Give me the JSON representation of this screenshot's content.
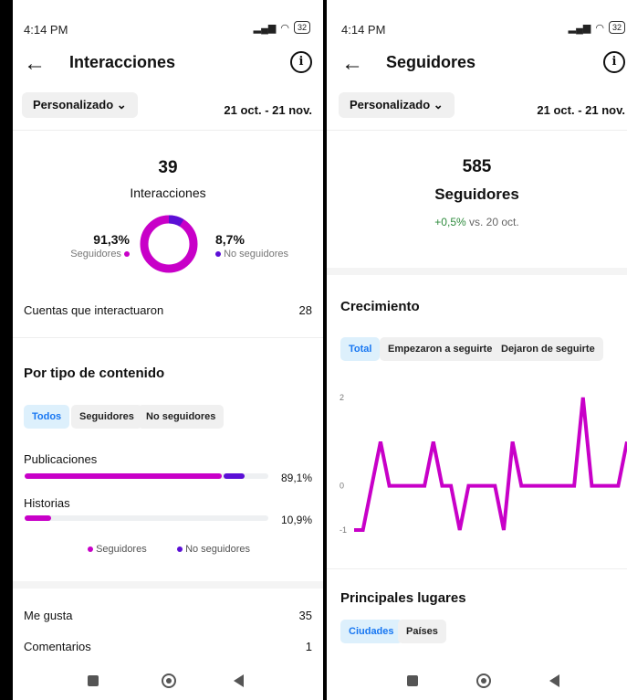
{
  "colors": {
    "magenta": "#c800c8",
    "purple": "#5b0fd6",
    "green": "#2e8b3d",
    "blue": "#1877f2"
  },
  "left": {
    "status": {
      "time": "4:14 PM",
      "battery": "32"
    },
    "header": {
      "title": "Interacciones"
    },
    "filter": {
      "dropdown": "Personalizado",
      "range": "21 oct. - 21 nov."
    },
    "summary": {
      "total": "39",
      "label": "Interacciones",
      "followers_pct": "91,3%",
      "followers_label": "Seguidores",
      "nonfollowers_pct": "8,7%",
      "nonfollowers_label": "No seguidores",
      "donut_followers_fraction": 0.913
    },
    "accounts": {
      "label": "Cuentas que interactuaron",
      "value": "28"
    },
    "by_type": {
      "title": "Por tipo de contenido",
      "tabs": [
        "Todos",
        "Seguidores",
        "No seguidores"
      ],
      "items": [
        {
          "label": "Publicaciones",
          "pct": "89,1%",
          "followers_fraction": 0.81,
          "nonfollowers_fraction": 0.085
        },
        {
          "label": "Historias",
          "pct": "10,9%",
          "followers_fraction": 0.109,
          "nonfollowers_fraction": 0
        }
      ],
      "legend_followers": "Seguidores",
      "legend_nonfollowers": "No seguidores"
    },
    "stats": [
      {
        "label": "Me gusta",
        "value": "35"
      },
      {
        "label": "Comentarios",
        "value": "1"
      }
    ]
  },
  "right": {
    "status": {
      "time": "4:14 PM",
      "battery": "32"
    },
    "header": {
      "title": "Seguidores"
    },
    "filter": {
      "dropdown": "Personalizado",
      "range": "21 oct. - 21 nov."
    },
    "summary": {
      "total": "585",
      "label": "Seguidores",
      "change": "+0,5%",
      "change_suffix": "vs. 20 oct."
    },
    "growth": {
      "title": "Crecimiento",
      "tabs": [
        "Total",
        "Empezaron a seguirte",
        "Dejaron de seguirte"
      ]
    },
    "places": {
      "title": "Principales lugares",
      "tabs": [
        "Ciudades",
        "Países"
      ]
    }
  },
  "chart_data": {
    "type": "line",
    "y_ticks": [
      "2",
      "0",
      "-1"
    ],
    "ylim": [
      -1,
      2
    ],
    "x": [
      0,
      1,
      2,
      3,
      4,
      5,
      6,
      7,
      8,
      9,
      10,
      11,
      12,
      13,
      14,
      15,
      16,
      17,
      18,
      19,
      20,
      21,
      22,
      23,
      24,
      25,
      26,
      27,
      28,
      29,
      30,
      31
    ],
    "series": [
      {
        "values": [
          -1,
          -1,
          0,
          1,
          0,
          0,
          0,
          0,
          0,
          1,
          0,
          0,
          -1,
          0,
          0,
          0,
          0,
          -1,
          1,
          0,
          0,
          0,
          0,
          0,
          0,
          0,
          2,
          0,
          0,
          0,
          0,
          1
        ]
      }
    ]
  }
}
